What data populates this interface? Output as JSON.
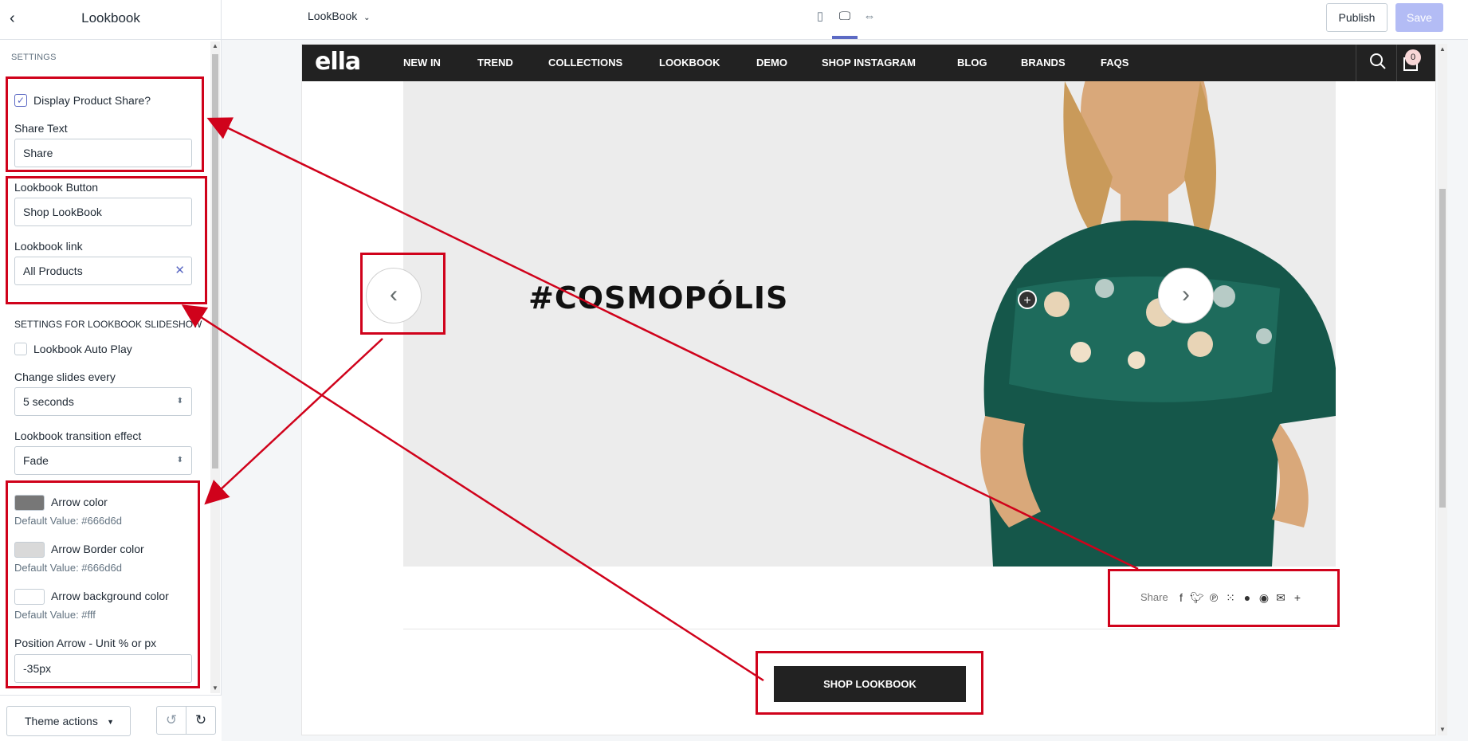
{
  "sidebar": {
    "back_glyph": "‹",
    "title": "Lookbook",
    "section_settings": "SETTINGS",
    "display_share_label": "Display Product Share?",
    "display_share_checked": true,
    "share_text_label": "Share Text",
    "share_text_value": "Share",
    "lookbook_button_label": "Lookbook Button",
    "lookbook_button_value": "Shop LookBook",
    "lookbook_link_label": "Lookbook link",
    "lookbook_link_value": "All Products",
    "section_slideshow": "SETTINGS FOR LOOKBOOK SLIDESHOW",
    "autoplay_label": "Lookbook Auto Play",
    "autoplay_checked": false,
    "change_slides_label": "Change slides every",
    "change_slides_value": "5 seconds",
    "transition_label": "Lookbook transition effect",
    "transition_value": "Fade",
    "arrow_color_label": "Arrow color",
    "arrow_color_default": "Default Value: #666d6d",
    "arrow_color_hex": "#666d6d",
    "arrow_border_label": "Arrow Border color",
    "arrow_border_default": "Default Value: #666d6d",
    "arrow_border_hex": "#d9d9d9",
    "arrow_bg_label": "Arrow background color",
    "arrow_bg_default": "Default Value: #fff",
    "arrow_bg_hex": "#ffffff",
    "position_label": "Position Arrow - Unit % or px",
    "position_value": "-35px"
  },
  "footer": {
    "theme_actions": "Theme actions"
  },
  "topbar": {
    "page_select": "LookBook",
    "publish": "Publish",
    "save": "Save"
  },
  "preview": {
    "logo": "ella",
    "nav": [
      "NEW IN",
      "TREND",
      "COLLECTIONS",
      "LOOKBOOK",
      "DEMO",
      "SHOP INSTAGRAM",
      "BLOG",
      "BRANDS",
      "FAQS"
    ],
    "cart_count": "0",
    "hero_title": "#COSMOPÓLIS",
    "share_label": "Share",
    "shop_button": "SHOP LOOKBOOK"
  },
  "colors": {
    "accent": "#5c6ac4",
    "annotation": "#d0021b",
    "nav_bg": "#222222"
  }
}
